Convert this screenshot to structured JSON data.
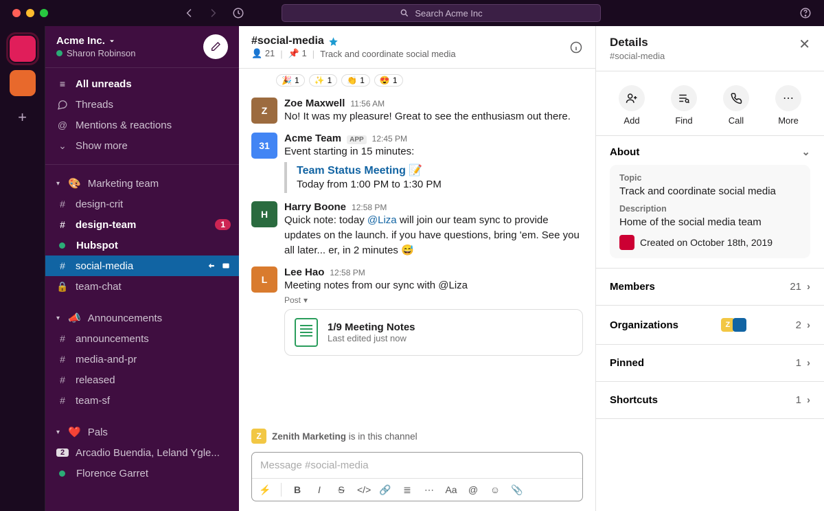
{
  "search": {
    "placeholder": "Search Acme Inc"
  },
  "workspace": {
    "name": "Acme Inc.",
    "user": "Sharon Robinson"
  },
  "nav": {
    "all_unreads": "All unreads",
    "threads": "Threads",
    "mentions": "Mentions & reactions",
    "show_more": "Show more"
  },
  "sections": {
    "marketing": {
      "label": "Marketing team",
      "emoji": "🎨",
      "channels": [
        {
          "name": "design-crit",
          "bold": false
        },
        {
          "name": "design-team",
          "bold": true,
          "badge": "1"
        },
        {
          "name": "Hubspot",
          "bold": true,
          "presence": "on"
        },
        {
          "name": "social-media",
          "active": true
        },
        {
          "name": "team-chat",
          "lock": true
        }
      ]
    },
    "announcements": {
      "label": "Announcements",
      "emoji": "📣",
      "channels": [
        {
          "name": "announcements"
        },
        {
          "name": "media-and-pr"
        },
        {
          "name": "released"
        },
        {
          "name": "team-sf"
        }
      ]
    },
    "pals": {
      "label": "Pals",
      "emoji": "❤️",
      "dms": [
        {
          "name": "Arcadio Buendia, Leland Ygle...",
          "count": "2"
        },
        {
          "name": "Florence Garret",
          "presence": "on"
        }
      ]
    }
  },
  "channel": {
    "title": "#social-media",
    "members": "21",
    "pins": "1",
    "topic": "Track and coordinate social media"
  },
  "reactions": [
    {
      "emoji": "🎉",
      "count": "1"
    },
    {
      "emoji": "✨",
      "count": "1"
    },
    {
      "emoji": "👏",
      "count": "1"
    },
    {
      "emoji": "😍",
      "count": "1"
    }
  ],
  "messages": {
    "zoe": {
      "name": "Zoe Maxwell",
      "time": "11:56 AM",
      "text": "No! It was my pleasure! Great to see the enthusiasm out there."
    },
    "acme": {
      "name": "Acme Team",
      "time": "12:45 PM",
      "line": "Event starting in 15 minutes:",
      "event_title": "Team Status Meeting",
      "event_emoji": "📝",
      "event_time": "Today from 1:00 PM to 1:30 PM"
    },
    "harry": {
      "name": "Harry Boone",
      "time": "12:58 PM",
      "pre": "Quick note: today ",
      "mention": "@Liza",
      "post": " will join our team sync to provide updates on the launch. if you have questions, bring 'em. See you all later... er, in 2 minutes 😅"
    },
    "lee": {
      "name": "Lee Hao",
      "time": "12:58 PM",
      "text": "Meeting notes from our sync with @Liza",
      "post_label": "Post",
      "card_title": "1/9 Meeting Notes",
      "card_sub": "Last edited just now"
    }
  },
  "inchannel": {
    "org": "Zenith Marketing",
    "suffix": " is in this channel"
  },
  "composer": {
    "placeholder": "Message #social-media"
  },
  "details": {
    "title": "Details",
    "sub": "#social-media",
    "actions": {
      "add": "Add",
      "find": "Find",
      "call": "Call",
      "more": "More"
    },
    "about": {
      "label": "About",
      "topic_k": "Topic",
      "topic_v": "Track and coordinate social media",
      "desc_k": "Description",
      "desc_v": "Home of the social media team",
      "created": "Created on October 18th, 2019"
    },
    "members": {
      "label": "Members",
      "count": "21"
    },
    "orgs": {
      "label": "Organizations",
      "count": "2"
    },
    "pinned": {
      "label": "Pinned",
      "count": "1"
    },
    "shortcuts": {
      "label": "Shortcuts",
      "count": "1"
    }
  }
}
